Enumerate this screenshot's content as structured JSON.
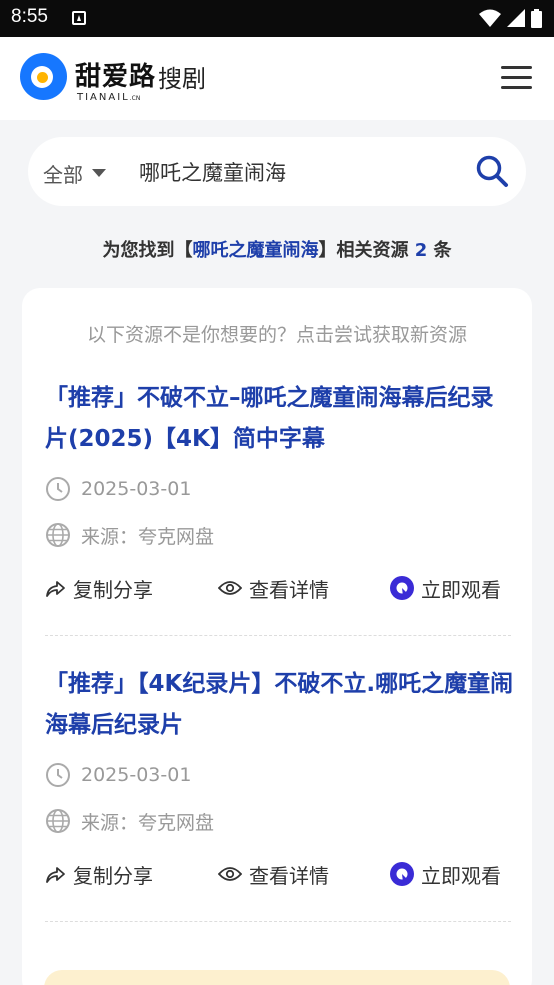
{
  "status_bar": {
    "time": "8:55"
  },
  "header": {
    "logo_main": "甜爱路",
    "logo_sub": "搜剧",
    "logo_en": "TIANAIL",
    "logo_en_suffix": ".CN"
  },
  "search": {
    "scope": "全部",
    "query": "哪吒之魔童闹海"
  },
  "summary": {
    "prefix": "为您找到【",
    "keyword": "哪吒之魔童闹海",
    "middle": "】相关资源",
    "count": "2",
    "suffix": "条"
  },
  "hint": "以下资源不是你想要的？点击尝试获取新资源",
  "results": [
    {
      "title": "「推荐」不破不立–哪吒之魔童闹海幕后纪录片(2025)【4K】简中字幕",
      "date": "2025-03-01",
      "source": "来源：夸克网盘",
      "copy": "复制分享",
      "detail": "查看详情",
      "watch": "立即观看"
    },
    {
      "title": "「推荐」【4K纪录片】不破不立.哪吒之魔童闹海幕后纪录片",
      "date": "2025-03-01",
      "source": "来源：夸克网盘",
      "copy": "复制分享",
      "detail": "查看详情",
      "watch": "立即观看"
    }
  ],
  "colors": {
    "accent": "#1e3faa",
    "brand": "#1677ff",
    "watch": "#3a2bd6"
  }
}
